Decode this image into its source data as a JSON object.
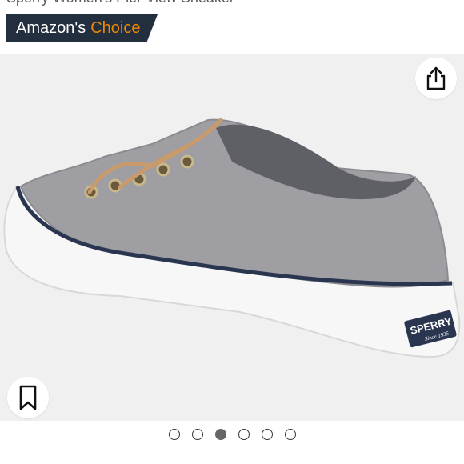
{
  "product": {
    "title": "Sperry Women's Pier View Sneaker"
  },
  "badge": {
    "brand_text": "Amazon's",
    "choice_text": "Choice",
    "background_color": "#232f3e",
    "choice_color": "#f08804"
  },
  "gallery": {
    "image_name": "gray-canvas-sneaker-photo",
    "logo_text": "SPERRY",
    "logo_subtext": "Since 1935",
    "share_icon": "share-icon",
    "save_icon": "bookmark-icon",
    "page_count": 6,
    "active_index": 2
  }
}
